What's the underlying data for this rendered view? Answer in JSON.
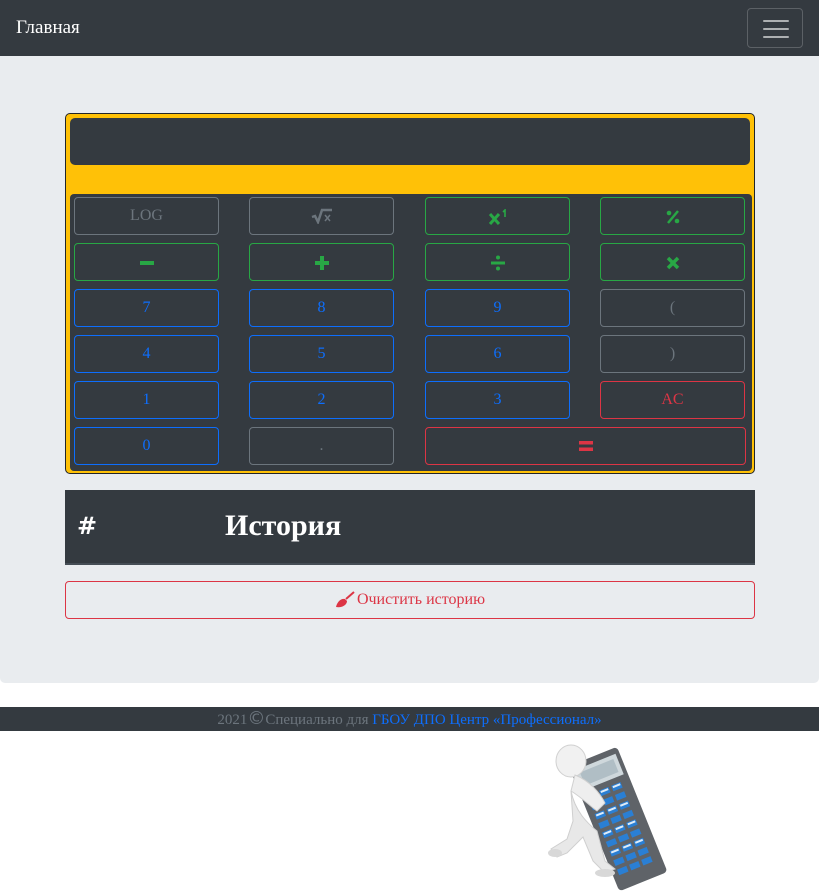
{
  "navbar": {
    "brand": "Главная"
  },
  "calculator": {
    "display_value": "",
    "rows": [
      [
        {
          "label": "LOG",
          "style": "secondary"
        },
        {
          "label": "√x",
          "style": "secondary",
          "icon": "square-root-icon"
        },
        {
          "label": "x¹",
          "style": "success",
          "icon": "superscript-icon"
        },
        {
          "label": "%",
          "style": "success",
          "icon": "percent-icon"
        }
      ],
      [
        {
          "label": "−",
          "style": "success",
          "icon": "minus-icon"
        },
        {
          "label": "+",
          "style": "success",
          "icon": "plus-icon"
        },
        {
          "label": "÷",
          "style": "success",
          "icon": "divide-icon"
        },
        {
          "label": "×",
          "style": "success",
          "icon": "times-icon"
        }
      ],
      [
        {
          "label": "7",
          "style": "primary"
        },
        {
          "label": "8",
          "style": "primary"
        },
        {
          "label": "9",
          "style": "primary"
        },
        {
          "label": "(",
          "style": "secondary"
        }
      ],
      [
        {
          "label": "4",
          "style": "primary"
        },
        {
          "label": "5",
          "style": "primary"
        },
        {
          "label": "6",
          "style": "primary"
        },
        {
          "label": ")",
          "style": "secondary"
        }
      ],
      [
        {
          "label": "1",
          "style": "primary"
        },
        {
          "label": "2",
          "style": "primary"
        },
        {
          "label": "3",
          "style": "primary"
        },
        {
          "label": "AC",
          "style": "danger"
        }
      ],
      [
        {
          "label": "0",
          "style": "primary"
        },
        {
          "label": ".",
          "style": "secondary"
        },
        {
          "label": "=",
          "style": "danger",
          "icon": "equals-icon"
        }
      ]
    ]
  },
  "history": {
    "hash": "#",
    "title": "История"
  },
  "clear_history": {
    "label": "Очистить историю",
    "icon": "broom-icon"
  },
  "footer": {
    "prefix": "2021",
    "copyright": "©",
    "text": "Специально для ",
    "link": "ГБОУ ДПО Центр «Профессионал»"
  },
  "illustration": {
    "icon": "person-carrying-calculator-icon"
  },
  "colors": {
    "navbar_bg": "#343a40",
    "calc_bg": "#ffc107",
    "primary": "#0d6efd",
    "success": "#28a745",
    "danger": "#dc3545",
    "secondary": "#6c757d",
    "page_bg": "#e9ecef"
  }
}
